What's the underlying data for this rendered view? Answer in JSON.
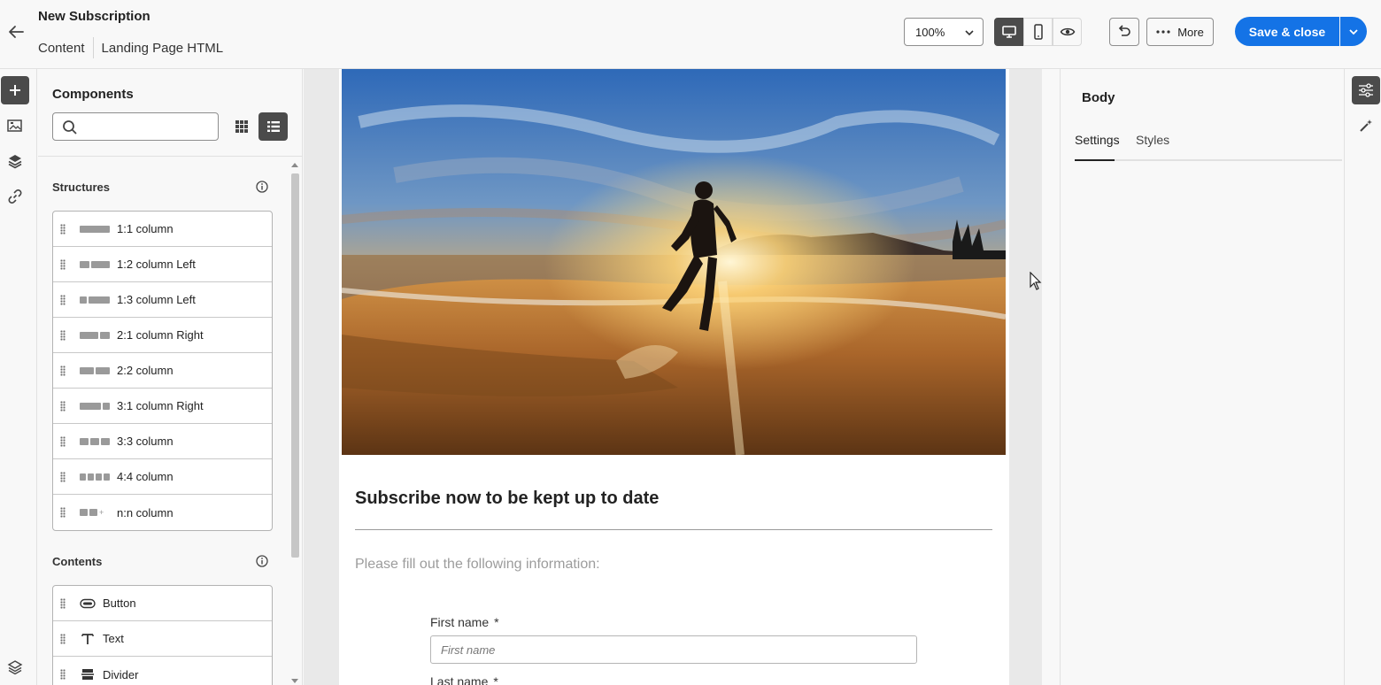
{
  "header": {
    "title": "New Subscription",
    "breadcrumbs": [
      "Content",
      "Landing Page HTML"
    ],
    "zoom": "100%",
    "more_label": "More",
    "save_label": "Save & close"
  },
  "components": {
    "title": "Components",
    "search_placeholder": "",
    "structures_title": "Structures",
    "structures": [
      {
        "label": "1:1 column"
      },
      {
        "label": "1:2 column Left"
      },
      {
        "label": "1:3 column Left"
      },
      {
        "label": "2:1 column Right"
      },
      {
        "label": "2:2 column"
      },
      {
        "label": "3:1 column Right"
      },
      {
        "label": "3:3 column"
      },
      {
        "label": "4:4 column"
      },
      {
        "label": "n:n column"
      }
    ],
    "contents_title": "Contents",
    "contents": [
      {
        "label": "Button",
        "icon": "button-icon"
      },
      {
        "label": "Text",
        "icon": "text-icon"
      },
      {
        "label": "Divider",
        "icon": "divider-icon"
      }
    ]
  },
  "canvas": {
    "heading": "Subscribe now to be kept up to date",
    "intro": "Please fill out the following information:",
    "fields": [
      {
        "label": "First name",
        "required": "*",
        "placeholder": "First name"
      },
      {
        "label": "Last name",
        "required": "*"
      }
    ]
  },
  "properties": {
    "title": "Body",
    "tabs": [
      "Settings",
      "Styles"
    ],
    "active_tab": "Settings"
  },
  "colors": {
    "accent": "#1473e6",
    "active_button": "#4b4b4b"
  }
}
